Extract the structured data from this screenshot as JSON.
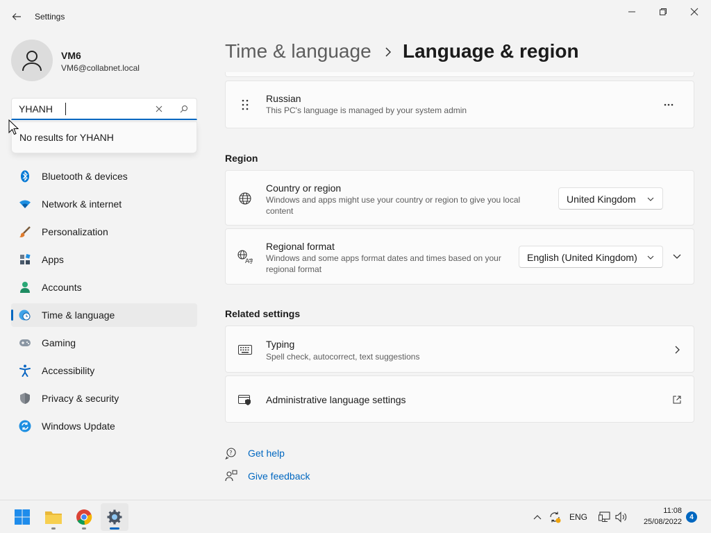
{
  "window": {
    "title": "Settings"
  },
  "user": {
    "name": "VM6",
    "email": "VM6@collabnet.local"
  },
  "search": {
    "value": "YHANH",
    "no_results": "No results for YHANH"
  },
  "sidebar": {
    "items": [
      {
        "label": "Bluetooth & devices",
        "icon": "bluetooth-icon"
      },
      {
        "label": "Network & internet",
        "icon": "wifi-icon"
      },
      {
        "label": "Personalization",
        "icon": "brush-icon"
      },
      {
        "label": "Apps",
        "icon": "apps-icon"
      },
      {
        "label": "Accounts",
        "icon": "person-icon"
      },
      {
        "label": "Time & language",
        "icon": "globe-clock-icon",
        "selected": true
      },
      {
        "label": "Gaming",
        "icon": "gamepad-icon"
      },
      {
        "label": "Accessibility",
        "icon": "accessibility-icon"
      },
      {
        "label": "Privacy & security",
        "icon": "shield-icon"
      },
      {
        "label": "Windows Update",
        "icon": "update-icon"
      }
    ]
  },
  "header": {
    "parent": "Time & language",
    "current": "Language & region"
  },
  "language": {
    "name": "Russian",
    "note": "This PC's language is managed by your system admin"
  },
  "region": {
    "section_title": "Region",
    "country": {
      "title": "Country or region",
      "desc": "Windows and apps might use your country or region to give you local content",
      "value": "United Kingdom"
    },
    "format": {
      "title": "Regional format",
      "desc": "Windows and some apps format dates and times based on your regional format",
      "value": "English (United Kingdom)"
    }
  },
  "related": {
    "section_title": "Related settings",
    "typing": {
      "title": "Typing",
      "desc": "Spell check, autocorrect, text suggestions"
    },
    "admin": {
      "title": "Administrative language settings"
    }
  },
  "links": {
    "help": "Get help",
    "feedback": "Give feedback"
  },
  "taskbar": {
    "lang": "ENG",
    "time": "11:08",
    "date": "25/08/2022",
    "notifications": "4"
  },
  "colors": {
    "accent": "#0067c0",
    "background": "#f3f3f3",
    "card": "#fbfbfb"
  }
}
